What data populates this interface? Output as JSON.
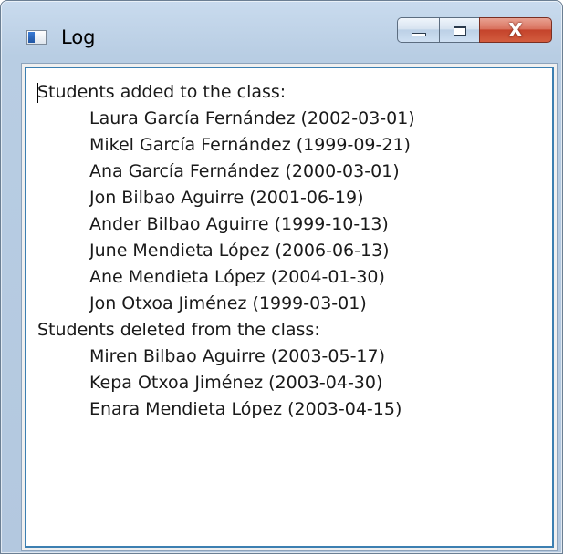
{
  "window": {
    "title": "Log",
    "close_glyph": "X",
    "icons": {
      "app": "window-icon",
      "minimize": "minimize-icon",
      "maximize": "maximize-icon",
      "close": "close-icon"
    },
    "colors": {
      "frame": "#b8cde3",
      "close_button": "#c4432b",
      "textbox_border": "#3c7fb1"
    }
  },
  "log": {
    "added_header": "Students added to the class:",
    "added": [
      "Laura García Fernández (2002-03-01)",
      "Mikel García Fernández (1999-09-21)",
      "Ana García Fernández (2000-03-01)",
      "Jon Bilbao Aguirre (2001-06-19)",
      "Ander Bilbao Aguirre (1999-10-13)",
      "June Mendieta López (2006-06-13)",
      "Ane Mendieta López (2004-01-30)",
      "Jon Otxoa Jiménez (1999-03-01)"
    ],
    "deleted_header": "Students deleted from the class:",
    "deleted": [
      "Miren Bilbao Aguirre (2003-05-17)",
      "Kepa Otxoa Jiménez (2003-04-30)",
      "Enara Mendieta López (2003-04-15)"
    ]
  }
}
